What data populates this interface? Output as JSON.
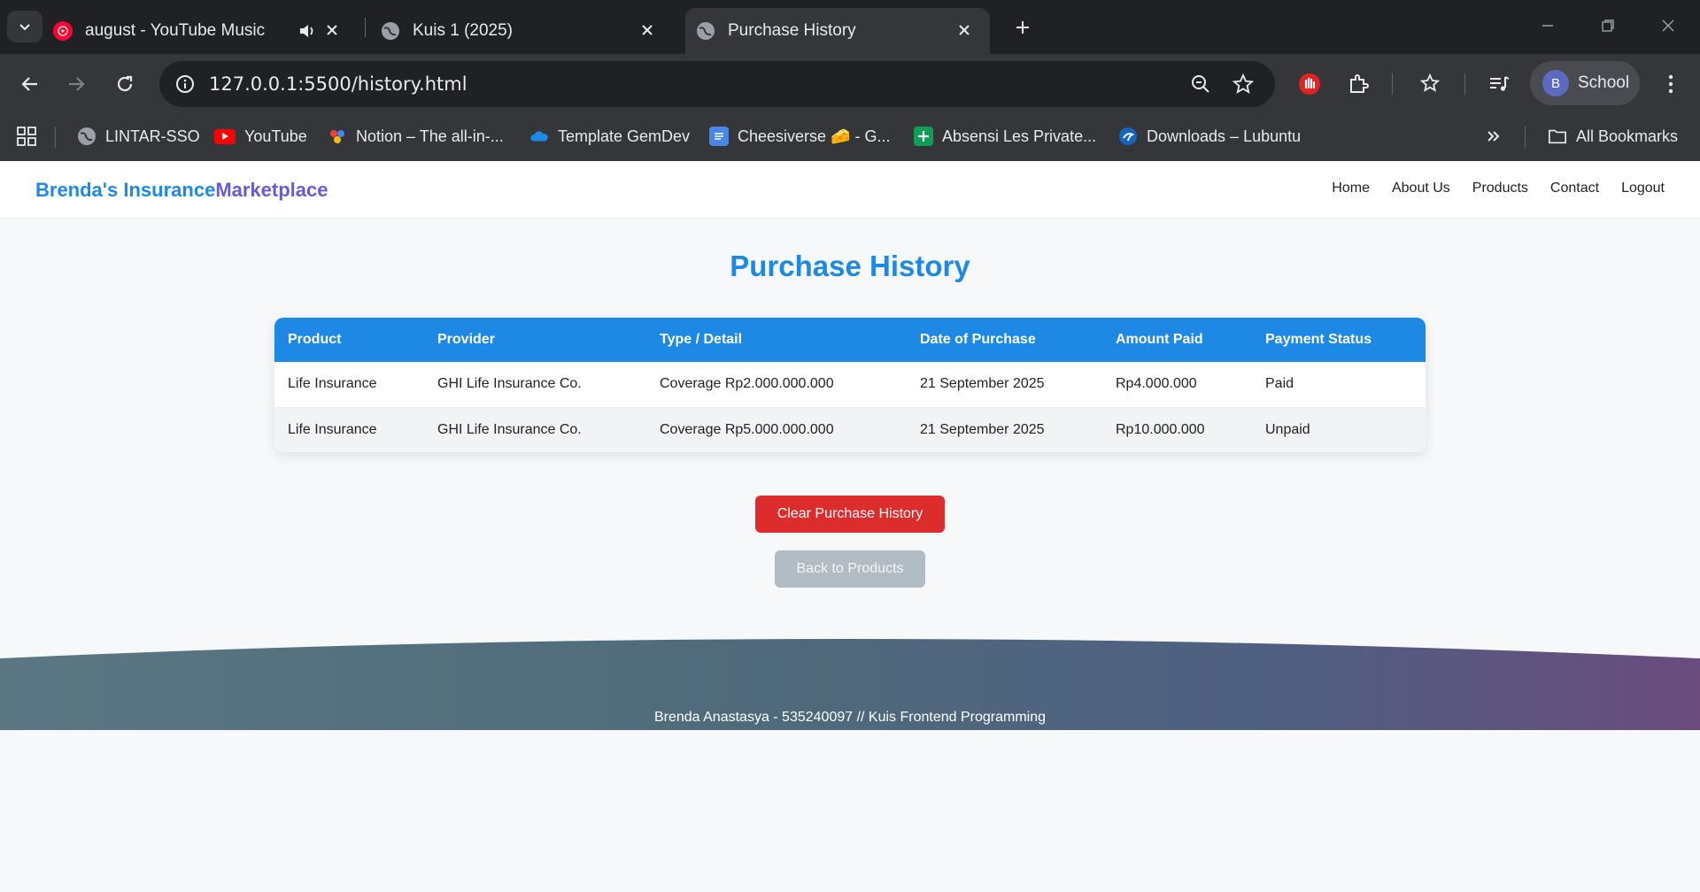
{
  "browser": {
    "tabs": [
      {
        "title": "august - YouTube Music",
        "icon": "youtube-music-icon",
        "audio": true
      },
      {
        "title": "Kuis 1 (2025)",
        "icon": "globe-icon"
      },
      {
        "title": "Purchase History",
        "icon": "globe-icon",
        "active": true
      }
    ],
    "url": "127.0.0.1:5500/history.html",
    "profile": {
      "initial": "B",
      "name": "School"
    },
    "bookmarks": [
      {
        "label": "LINTAR-SSO",
        "icon": "globe-icon"
      },
      {
        "label": "YouTube",
        "icon": "youtube-icon"
      },
      {
        "label": "Notion – The all-in-...",
        "icon": "notion-icon"
      },
      {
        "label": "Template GemDev",
        "icon": "onedrive-icon"
      },
      {
        "label": "Cheesiverse 🧀 - G...",
        "icon": "docs-icon"
      },
      {
        "label": "Absensi Les Private...",
        "icon": "sheets-icon"
      },
      {
        "label": "Downloads – Lubuntu",
        "icon": "lubuntu-icon"
      }
    ],
    "all_bookmarks": "All Bookmarks"
  },
  "site": {
    "brand_part1": "Brenda's Insurance",
    "brand_part2": "Marketplace",
    "nav": [
      "Home",
      "About Us",
      "Products",
      "Contact",
      "Logout"
    ]
  },
  "main": {
    "title": "Purchase History",
    "table": {
      "headers": [
        "Product",
        "Provider",
        "Type / Detail",
        "Date of Purchase",
        "Amount Paid",
        "Payment Status"
      ],
      "rows": [
        [
          "Life Insurance",
          "GHI Life Insurance Co.",
          "Coverage Rp2.000.000.000",
          "21 September 2025",
          "Rp4.000.000",
          "Paid"
        ],
        [
          "Life Insurance",
          "GHI Life Insurance Co.",
          "Coverage Rp5.000.000.000",
          "21 September 2025",
          "Rp10.000.000",
          "Unpaid"
        ]
      ]
    },
    "clear_button": "Clear Purchase History",
    "back_button": "Back to Products"
  },
  "footer": {
    "text": "Brenda Anastasya - 535240097 // Kuis Frontend Programming"
  },
  "colors": {
    "accent": "#1e88e5",
    "brand_secondary": "#6a5acd",
    "danger": "#dc2c2c",
    "muted_button": "#b2bcc4"
  }
}
